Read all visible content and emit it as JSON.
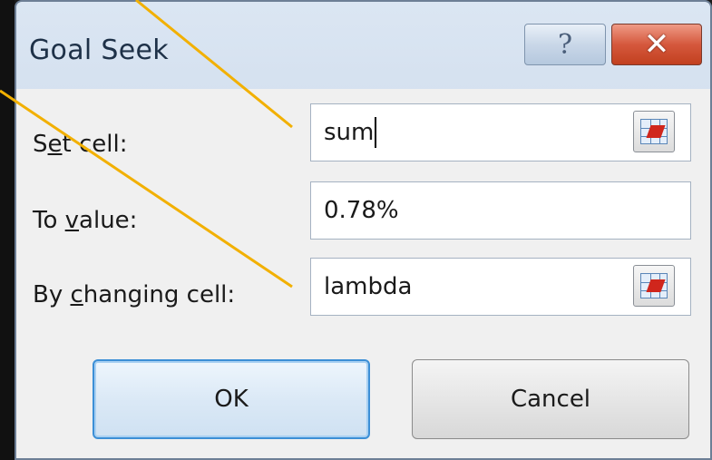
{
  "dialog": {
    "title": "Goal Seek",
    "help_glyph": "?",
    "close_glyph": "✕"
  },
  "fields": {
    "set_cell": {
      "label_pre": "S",
      "label_mnemonic": "e",
      "label_post": "t cell:",
      "value": "sum"
    },
    "to_value": {
      "label_pre": "To ",
      "label_mnemonic": "v",
      "label_post": "alue:",
      "value": "0.78%"
    },
    "changing_cell": {
      "label_pre": "By ",
      "label_mnemonic": "c",
      "label_post": "hanging cell:",
      "value": "lambda"
    }
  },
  "buttons": {
    "ok": "OK",
    "cancel": "Cancel"
  },
  "icons": {
    "help": "help-icon",
    "close": "close-icon",
    "range_select": "range-select-icon"
  },
  "colors": {
    "annotation_line": "#f2b000",
    "close_button": "#c94a2c",
    "ok_focus_border": "#3c8fd6"
  }
}
